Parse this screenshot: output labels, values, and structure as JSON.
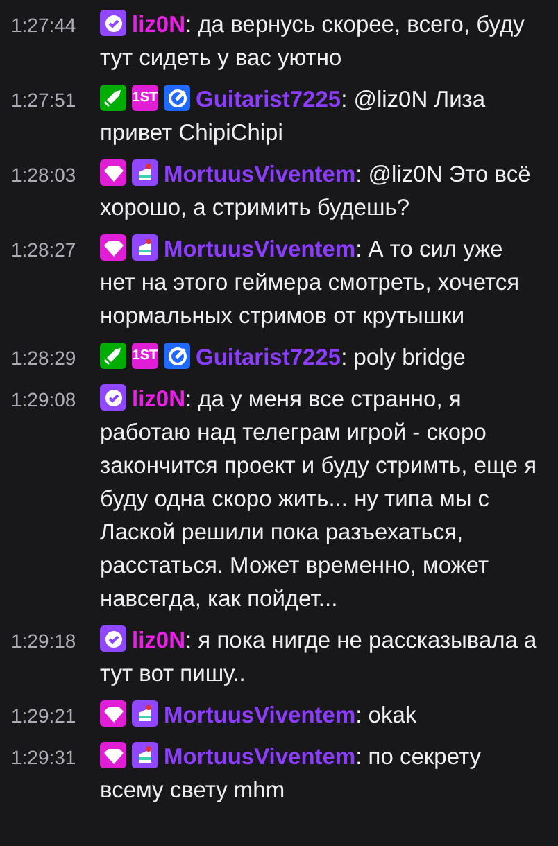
{
  "messages": [
    {
      "time": "1:27:44",
      "badges": [
        {
          "kind": "verified"
        }
      ],
      "user": "liz0N",
      "color": "#eb1ee8",
      "text": ": да вернусь скорее, всего, буду тут сидеть у вас уютно"
    },
    {
      "time": "1:27:51",
      "badges": [
        {
          "kind": "sword"
        },
        {
          "kind": "first",
          "label": "1ST"
        },
        {
          "kind": "wrench"
        }
      ],
      "user": "Guitarist7225",
      "color": "#8c3cff",
      "text": ": @liz0N Лиза привет ChipiChipi"
    },
    {
      "time": "1:28:03",
      "badges": [
        {
          "kind": "gem"
        },
        {
          "kind": "cake"
        }
      ],
      "user": "MortuusViventem",
      "color": "#8c3cff",
      "text": ": @liz0N Это всё хорошо, а стримить будешь?"
    },
    {
      "time": "1:28:27",
      "badges": [
        {
          "kind": "gem"
        },
        {
          "kind": "cake"
        }
      ],
      "user": "MortuusViventem",
      "color": "#8c3cff",
      "text": ": А то сил уже нет на этого геймера смотреть, хочется нормальных стримов от крутышки"
    },
    {
      "time": "1:28:29",
      "badges": [
        {
          "kind": "sword"
        },
        {
          "kind": "first",
          "label": "1ST"
        },
        {
          "kind": "wrench"
        }
      ],
      "user": "Guitarist7225",
      "color": "#8c3cff",
      "text": ": poly bridge"
    },
    {
      "time": "1:29:08",
      "badges": [
        {
          "kind": "verified"
        }
      ],
      "user": "liz0N",
      "color": "#eb1ee8",
      "text": ": да у меня все странно, я работаю над телеграм игрой - скоро закончится проект и буду стримть, еще я буду одна скоро жить... ну типа мы с Лаской решили пока разъехаться, расстаться. Может временно, может навсегда, как пойдет..."
    },
    {
      "time": "1:29:18",
      "badges": [
        {
          "kind": "verified"
        }
      ],
      "user": "liz0N",
      "color": "#eb1ee8",
      "text": ": я пока нигде не рассказывала а тут вот пишу.."
    },
    {
      "time": "1:29:21",
      "badges": [
        {
          "kind": "gem"
        },
        {
          "kind": "cake"
        }
      ],
      "user": "MortuusViventem",
      "color": "#8c3cff",
      "text": ": okak"
    },
    {
      "time": "1:29:31",
      "badges": [
        {
          "kind": "gem"
        },
        {
          "kind": "cake"
        }
      ],
      "user": "MortuusViventem",
      "color": "#8c3cff",
      "text": ": по секрету всему свету mhm"
    }
  ]
}
